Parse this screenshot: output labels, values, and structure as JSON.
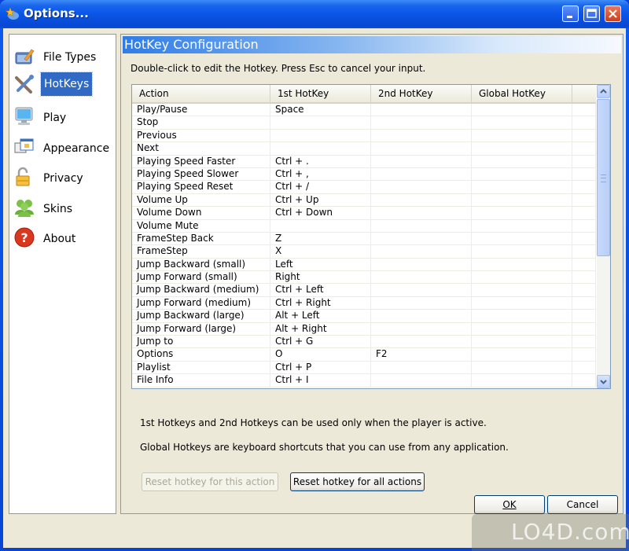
{
  "window": {
    "title": "Options..."
  },
  "sidebar": {
    "items": [
      {
        "label": "File Types",
        "icon": "file-types-icon",
        "active": false
      },
      {
        "label": "HotKeys",
        "icon": "tools-icon",
        "active": true
      },
      {
        "label": "Play",
        "icon": "monitor-icon",
        "active": false
      },
      {
        "label": "Appearance",
        "icon": "window-icon",
        "active": false
      },
      {
        "label": "Privacy",
        "icon": "padlock-icon",
        "active": false
      },
      {
        "label": "Skins",
        "icon": "users-icon",
        "active": false
      },
      {
        "label": "About",
        "icon": "help-icon",
        "active": false
      }
    ]
  },
  "panel": {
    "title": "HotKey Configuration",
    "instruction": "Double-click to edit the Hotkey. Press Esc to cancel your input.",
    "table": {
      "columns": [
        "Action",
        "1st HotKey",
        "2nd HotKey",
        "Global HotKey"
      ],
      "rows": [
        [
          "Play/Pause",
          "Space",
          "",
          ""
        ],
        [
          "Stop",
          "",
          "",
          ""
        ],
        [
          "Previous",
          "",
          "",
          ""
        ],
        [
          "Next",
          "",
          "",
          ""
        ],
        [
          "Playing Speed Faster",
          "Ctrl + .",
          "",
          ""
        ],
        [
          "Playing Speed Slower",
          "Ctrl + ,",
          "",
          ""
        ],
        [
          "Playing Speed Reset",
          "Ctrl + /",
          "",
          ""
        ],
        [
          "Volume Up",
          "Ctrl + Up",
          "",
          ""
        ],
        [
          "Volume Down",
          "Ctrl + Down",
          "",
          ""
        ],
        [
          "Volume Mute",
          "",
          "",
          ""
        ],
        [
          "FrameStep Back",
          "Z",
          "",
          ""
        ],
        [
          "FrameStep",
          "X",
          "",
          ""
        ],
        [
          "Jump Backward (small)",
          "Left",
          "",
          ""
        ],
        [
          "Jump Forward (small)",
          "Right",
          "",
          ""
        ],
        [
          "Jump Backward (medium)",
          "Ctrl + Left",
          "",
          ""
        ],
        [
          "Jump Forward (medium)",
          "Ctrl + Right",
          "",
          ""
        ],
        [
          "Jump Backward (large)",
          "Alt + Left",
          "",
          ""
        ],
        [
          "Jump Forward (large)",
          "Alt + Right",
          "",
          ""
        ],
        [
          "Jump to",
          "Ctrl + G",
          "",
          ""
        ],
        [
          "Options",
          "O",
          "F2",
          ""
        ],
        [
          "Playlist",
          "Ctrl + P",
          "",
          ""
        ],
        [
          "File Info",
          "Ctrl + I",
          "",
          ""
        ]
      ]
    },
    "note1": "1st Hotkeys and 2nd Hotkeys can be used only when the player is active.",
    "note2": "Global Hotkeys are keyboard shortcuts that you can use from any application.",
    "reset_one_label": "Reset hotkey for this action",
    "reset_all_label": "Reset hotkey for all actions"
  },
  "footer": {
    "ok_label": "OK",
    "cancel_label": "Cancel"
  },
  "watermark": "LO4D.com"
}
